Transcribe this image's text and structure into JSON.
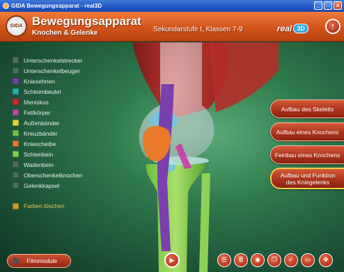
{
  "window": {
    "title": "GIDA Bewegungsapparat - real3D",
    "minimize": "_",
    "maximize": "□",
    "close": "x"
  },
  "header": {
    "logo_text": "GIDA",
    "title": "Bewegungsapparat",
    "subtitle": "Knochen & Gelenke",
    "level": "Sekundarstufe I, Klassen 7-9",
    "brand_word": "real",
    "brand_badge": "3D",
    "up_icon": "up-arrow-icon"
  },
  "legend": {
    "items": [
      {
        "label": "Unterschenkelstrecker",
        "color": "#4f6f5c"
      },
      {
        "label": "Unterschenkelbeuger",
        "color": "#4f6f5c"
      },
      {
        "label": "Kniesehnen",
        "color": "#7b3fb0"
      },
      {
        "label": "Schleimbeutel",
        "color": "#1fb3b3"
      },
      {
        "label": "Meniskus",
        "color": "#d8272a"
      },
      {
        "label": "Fettkörper",
        "color": "#c54aa8"
      },
      {
        "label": "Außenbänder",
        "color": "#d9d63a"
      },
      {
        "label": "Kreuzbänder",
        "color": "#6fc04a"
      },
      {
        "label": "Kniescheibe",
        "color": "#e87a2a"
      },
      {
        "label": "Schienbein",
        "color": "#7bd34d"
      },
      {
        "label": "Wadenbein",
        "color": "#4f6f5c"
      },
      {
        "label": "Oberschenkelknochen",
        "color": "#4f6f5c"
      },
      {
        "label": "Gelenkkapsel",
        "color": "#4f6f5c"
      }
    ],
    "clear_label": "Farben löschen",
    "clear_color": "#c69a2e"
  },
  "nav": {
    "buttons": [
      {
        "label": "Aufbau des Skeletts"
      },
      {
        "label": "Aufbau eines Knochens"
      },
      {
        "label": "Feinbau eines Knochens"
      },
      {
        "label_line1": "Aufbau und Funktion",
        "label_line2": "des Kniegelenks"
      }
    ]
  },
  "bottom": {
    "film_label": "Filmmodule",
    "film_icon": "film-camera-icon",
    "play_icon": "play-icon",
    "tools": [
      {
        "icon": "list-icon",
        "glyph": "☰"
      },
      {
        "icon": "text-list-icon",
        "glyph": "≣"
      },
      {
        "icon": "camera-icon",
        "glyph": "◉"
      },
      {
        "icon": "copy-icon",
        "glyph": "❐"
      },
      {
        "icon": "check-icon",
        "glyph": "✓"
      },
      {
        "icon": "window-icon",
        "glyph": "▭"
      },
      {
        "icon": "move-icon",
        "glyph": "✥"
      }
    ]
  },
  "colors": {
    "accent": "#c8461a",
    "background": "#2f7a4d"
  }
}
